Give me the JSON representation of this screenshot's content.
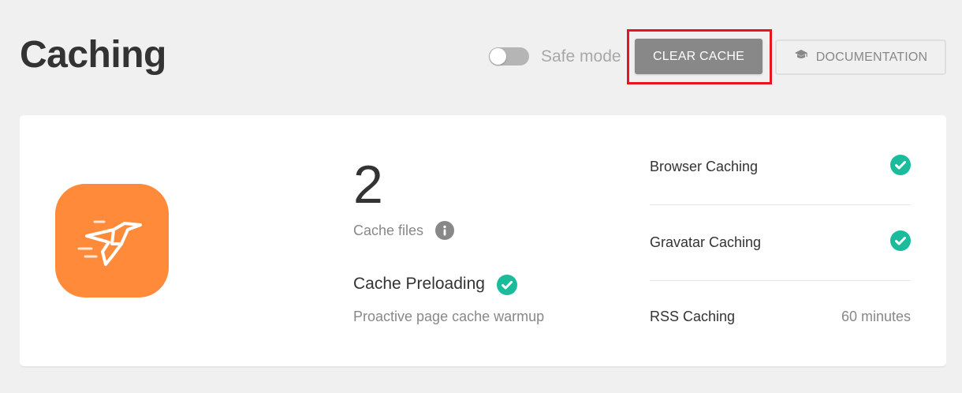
{
  "header": {
    "title": "Caching",
    "safe_mode_label": "Safe mode",
    "safe_mode_on": false,
    "clear_cache_label": "CLEAR CACHE",
    "documentation_label": "DOCUMENTATION",
    "documentation_icon": "graduation-cap-icon"
  },
  "summary": {
    "cache_count": "2",
    "cache_files_label": "Cache files",
    "info_icon": "info-icon",
    "preload_title": "Cache Preloading",
    "preload_status_icon": "check-icon",
    "preload_description": "Proactive page cache warmup"
  },
  "features": [
    {
      "label": "Browser Caching",
      "status": "enabled",
      "icon": "check-icon"
    },
    {
      "label": "Gravatar Caching",
      "status": "enabled",
      "icon": "check-icon"
    },
    {
      "label": "RSS Caching",
      "value": "60 minutes"
    }
  ],
  "colors": {
    "accent_orange": "#ff8b3a",
    "success_green": "#1abc9c",
    "highlight_red": "#e8151e",
    "button_gray": "#888888"
  }
}
